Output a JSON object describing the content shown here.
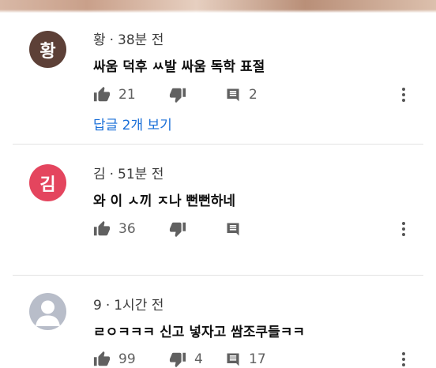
{
  "comments": [
    {
      "avatar_letter": "황",
      "avatar_color": "#5d4037",
      "author": "황",
      "time": "38분 전",
      "text": "싸움 덕후 ㅆ발 싸움 독학 표절",
      "likes": "21",
      "replies": "2",
      "replies_link": "답글 2개 보기"
    },
    {
      "avatar_letter": "김",
      "avatar_color": "#e4455e",
      "author": "김",
      "time": "51분 전",
      "text": "와 이 ㅅ끼 ㅈ나 뻔뻔하네",
      "likes": "36"
    },
    {
      "author": "9",
      "time": "1시간 전",
      "text": "ㄹㅇㅋㅋㅋ 신고 넣자고 쌈조쿠들ㅋㅋ",
      "likes": "99",
      "dislikes": "4",
      "replies": "17",
      "avatar_color": "#b8bdc9"
    }
  ],
  "separator": "·",
  "colors": {
    "link": "#1a6fd8",
    "icon": "#606060"
  }
}
